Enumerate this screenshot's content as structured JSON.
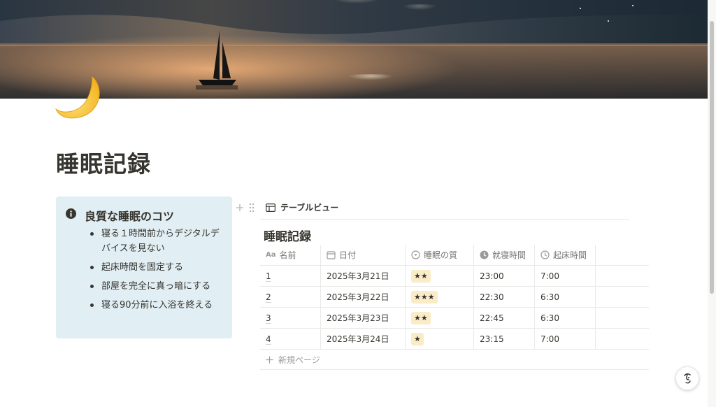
{
  "page": {
    "title": "睡眠記録"
  },
  "callout": {
    "title": "良質な睡眠のコツ",
    "items": [
      "寝る１時間前からデジタルデバイスを見ない",
      "起床時間を固定する",
      "部屋を完全に真っ暗にする",
      "寝る90分前に入浴を終える"
    ]
  },
  "database": {
    "view_label": "テーブルビュー",
    "title": "睡眠記録",
    "columns": [
      "名前",
      "日付",
      "睡眠の質",
      "就寝時間",
      "起床時間"
    ],
    "column_icons": [
      "Aa",
      "calendar-icon",
      "select-icon",
      "clock-icon",
      "clock-icon"
    ],
    "rows": [
      {
        "name": "1",
        "date": "2025年3月21日",
        "quality": "★★",
        "bedtime": "23:00",
        "wake": "7:00"
      },
      {
        "name": "2",
        "date": "2025年3月22日",
        "quality": "★★★",
        "bedtime": "22:30",
        "wake": "6:30"
      },
      {
        "name": "3",
        "date": "2025年3月23日",
        "quality": "★★",
        "bedtime": "22:45",
        "wake": "6:30"
      },
      {
        "name": "4",
        "date": "2025年3月24日",
        "quality": "★",
        "bedtime": "23:15",
        "wake": "7:00"
      }
    ],
    "new_page_label": "新規ページ"
  },
  "colors": {
    "callout_bg": "#e1eef4",
    "tag_bg": "#fbecc8",
    "text": "#37352f"
  }
}
